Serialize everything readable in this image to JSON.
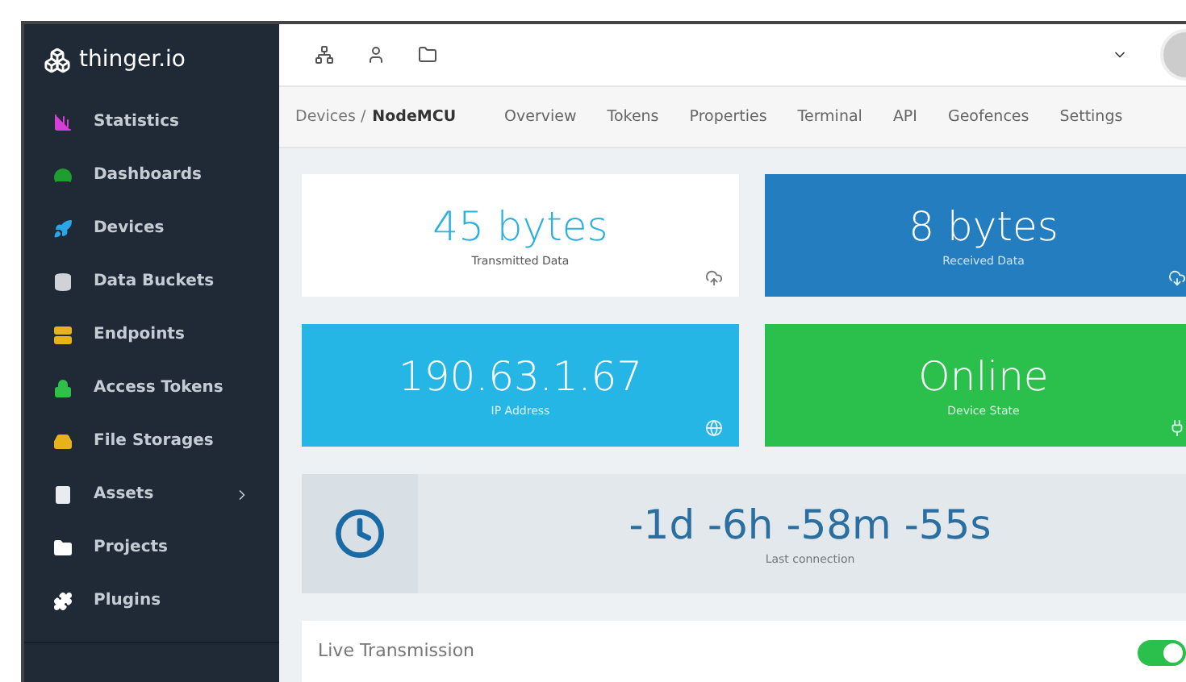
{
  "brand": {
    "name": "thinger.io"
  },
  "sidebar": {
    "items": [
      {
        "label": "Statistics",
        "color": "#d63fd6"
      },
      {
        "label": "Dashboards",
        "color": "#1e9e2e"
      },
      {
        "label": "Devices",
        "color": "#2aa6e6"
      },
      {
        "label": "Data Buckets",
        "color": "#cfd3d8"
      },
      {
        "label": "Endpoints",
        "color": "#e8b21a"
      },
      {
        "label": "Access Tokens",
        "color": "#2fbf4a"
      },
      {
        "label": "File Storages",
        "color": "#e8b21a"
      },
      {
        "label": "Assets",
        "color": "#e8ecf0",
        "has_submenu": true
      },
      {
        "label": "Projects",
        "color": "#ffffff"
      },
      {
        "label": "Plugins",
        "color": "#ffffff"
      }
    ]
  },
  "breadcrumb": {
    "parent": "Devices /",
    "current": "NodeMCU"
  },
  "tabs": [
    "Overview",
    "Tokens",
    "Properties",
    "Terminal",
    "API",
    "Geofences",
    "Settings"
  ],
  "stats": [
    {
      "value": "45 bytes",
      "label": "Transmitted Data",
      "kind": "white"
    },
    {
      "value": "8 bytes",
      "label": "Received Data",
      "kind": "blue"
    },
    {
      "value": "190.63.1.67",
      "label": "IP Address",
      "kind": "cyan"
    },
    {
      "value": "Online",
      "label": "Device State",
      "kind": "green"
    }
  ],
  "last_connection": {
    "value": "-1d -6h -58m -55s",
    "label": "Last connection"
  },
  "live_transmission": {
    "label": "Live Transmission",
    "on": true
  }
}
